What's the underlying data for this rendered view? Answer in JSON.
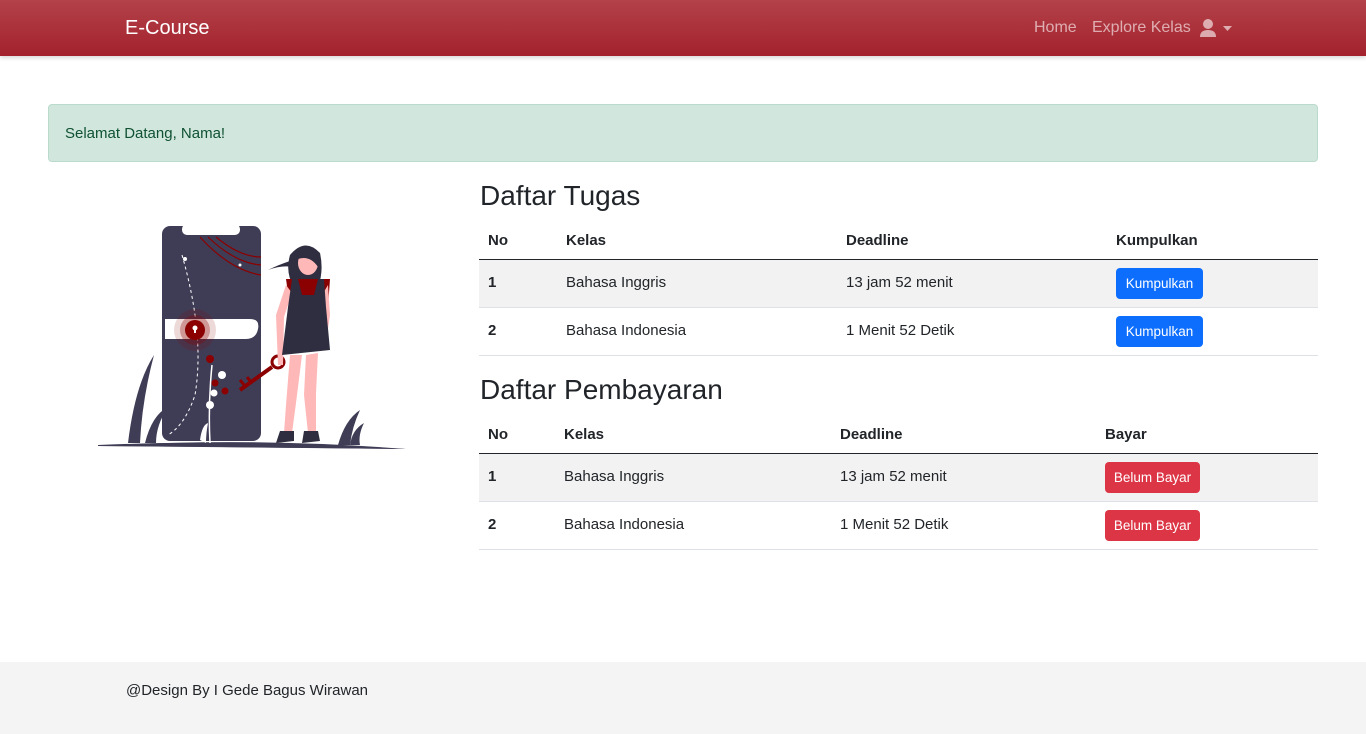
{
  "navbar": {
    "brand": "E-Course",
    "links": [
      "Home",
      "Explore Kelas"
    ],
    "user_icon": "user-icon",
    "caret_icon": "caret-down-icon"
  },
  "alert": {
    "text": "Selamat Datang, Nama!"
  },
  "illustration": {
    "description_icon": "woman-with-key-and-phone-illustration"
  },
  "tugas": {
    "title": "Daftar Tugas",
    "headers": [
      "No",
      "Kelas",
      "Deadline",
      "Kumpulkan"
    ],
    "rows": [
      {
        "no": "1",
        "kelas": "Bahasa Inggris",
        "deadline": "13 jam 52 menit",
        "action": "Kumpulkan"
      },
      {
        "no": "2",
        "kelas": "Bahasa Indonesia",
        "deadline": "1 Menit 52 Detik",
        "action": "Kumpulkan"
      }
    ]
  },
  "pembayaran": {
    "title": "Daftar Pembayaran",
    "headers": [
      "No",
      "Kelas",
      "Deadline",
      "Bayar"
    ],
    "rows": [
      {
        "no": "1",
        "kelas": "Bahasa Inggris",
        "deadline": "13 jam 52 menit",
        "action": "Belum Bayar"
      },
      {
        "no": "2",
        "kelas": "Bahasa Indonesia",
        "deadline": "1 Menit 52 Detik",
        "action": "Belum Bayar"
      }
    ]
  },
  "footer": {
    "text": "@Design By I Gede Bagus Wirawan"
  },
  "colors": {
    "navbar": "#a3212c",
    "accent": "#8b0000",
    "primary": "#0d6efd",
    "danger": "#dc3545",
    "alert_bg": "#d1e7dd"
  }
}
